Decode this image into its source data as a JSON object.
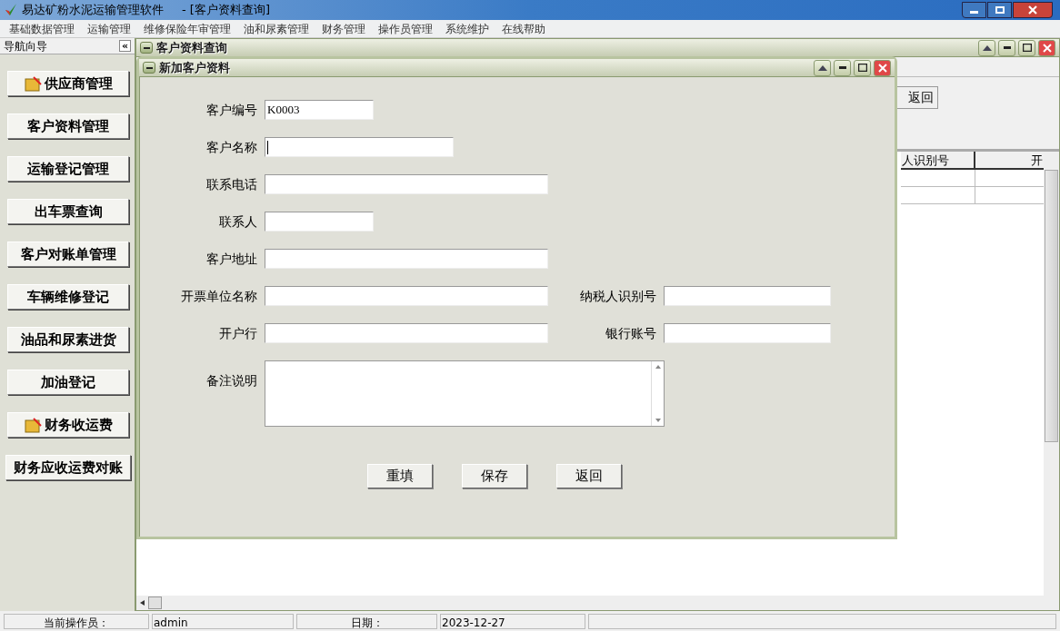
{
  "window": {
    "title": "易达矿粉水泥运输管理软件",
    "document": "- [客户资料查询]"
  },
  "menu": [
    "基础数据管理",
    "运输管理",
    "维修保险年审管理",
    "油和尿素管理",
    "财务管理",
    "操作员管理",
    "系统维护",
    "在线帮助"
  ],
  "navigator": {
    "title": "导航向导",
    "collapse": "«",
    "items": [
      {
        "label": "供应商管理",
        "kind": "with-icon"
      },
      {
        "label": "客户资料管理",
        "kind": "plain"
      },
      {
        "label": "运输登记管理",
        "kind": "plain"
      },
      {
        "label": "出车票查询",
        "kind": "plain"
      },
      {
        "label": "客户对账单管理",
        "kind": "plain"
      },
      {
        "label": "车辆维修登记",
        "kind": "plain"
      },
      {
        "label": "油品和尿素进货",
        "kind": "plain"
      },
      {
        "label": "加油登记",
        "kind": "plain"
      },
      {
        "label": "财务收运费",
        "kind": "with-icon"
      },
      {
        "label": "财务应收运费对账",
        "kind": "plain"
      }
    ]
  },
  "child_window": {
    "title": "客户资料查询",
    "button": "返回",
    "table": {
      "columns": [
        "人识别号",
        "开"
      ]
    }
  },
  "dialog": {
    "title": "新加客户资料",
    "rows": [
      [
        {
          "label": "客户编号",
          "value": "K0003",
          "kind": "short",
          "focused": false
        }
      ],
      [
        {
          "label": "客户名称",
          "kind": "medium",
          "focused": true
        }
      ],
      [
        {
          "label": "联系电话",
          "kind": "long",
          "focused": false
        }
      ],
      [
        {
          "label": "联系人",
          "kind": "short",
          "focused": false
        }
      ],
      [
        {
          "label": "客户地址",
          "kind": "long",
          "focused": false
        }
      ],
      [
        {
          "label": "开票单位名称",
          "kind": "long",
          "focused": false
        },
        {
          "label": "纳税人识别号",
          "kind": "right",
          "focused": false
        }
      ],
      [
        {
          "label": "开户行",
          "kind": "long",
          "focused": false
        },
        {
          "label": "银行账号",
          "kind": "right",
          "focused": false
        }
      ]
    ],
    "notes": {
      "label": "备注说明"
    },
    "buttons": [
      "重填",
      "保存",
      "返回"
    ]
  },
  "status_bar": [
    {
      "label": "当前操作员：",
      "value": "admin"
    },
    {
      "label": "日期：",
      "value": "2023-12-27"
    }
  ]
}
